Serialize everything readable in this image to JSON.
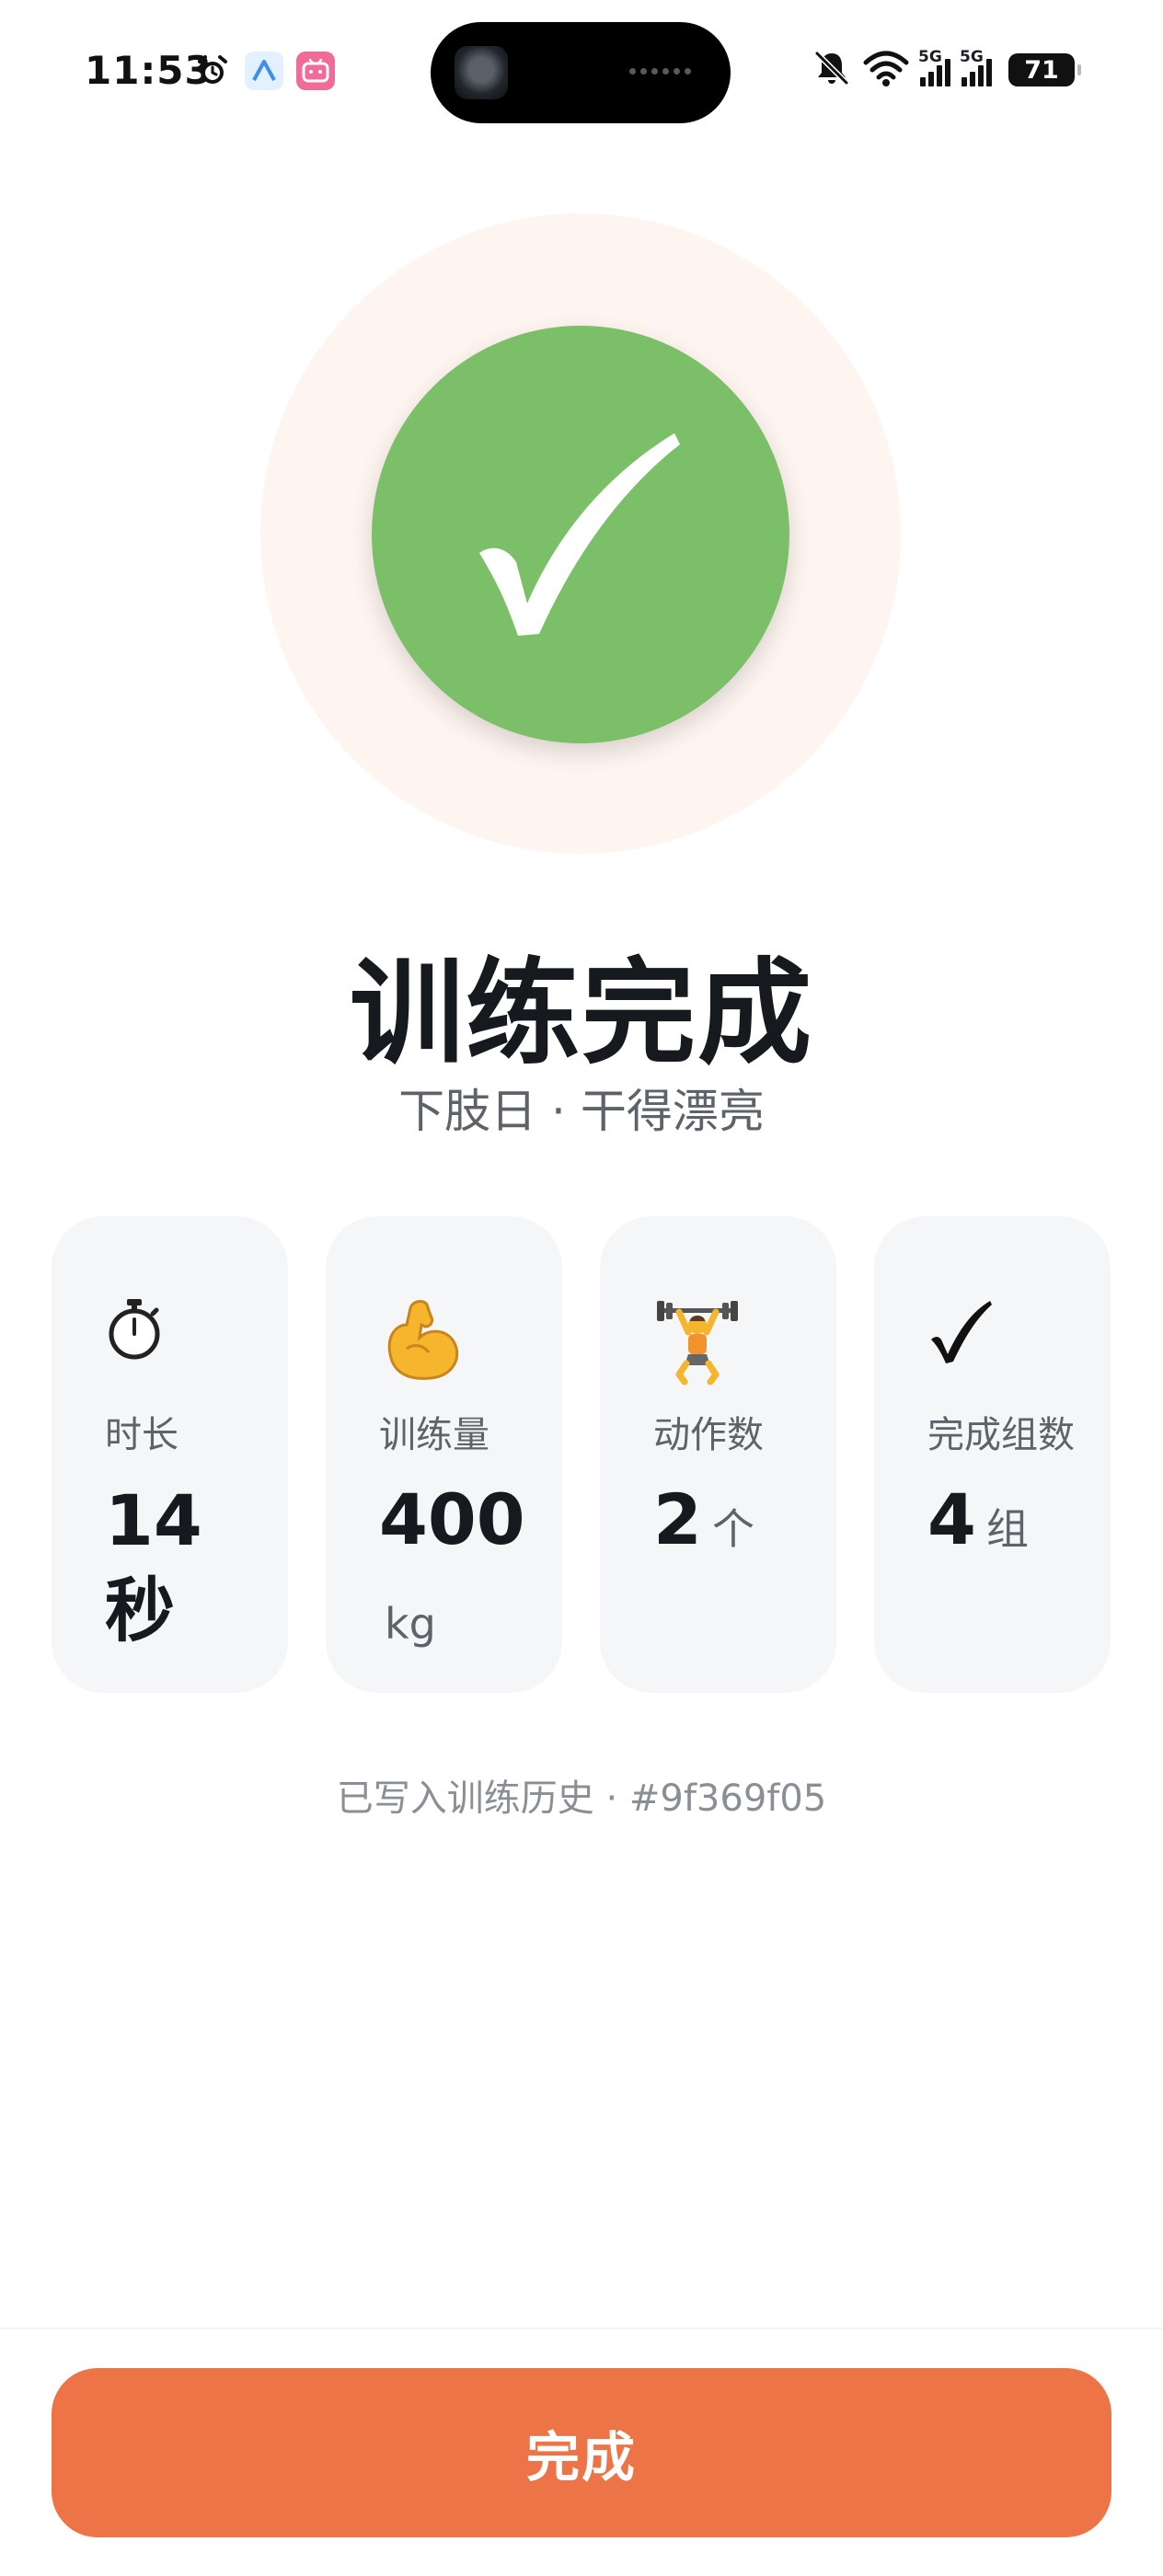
{
  "status_bar": {
    "time": "11:53",
    "network_label_1": "5G",
    "network_label_2": "5G",
    "battery_level": "71",
    "icons": [
      "alarm-icon",
      "app-a-icon",
      "bilibili-icon",
      "mute-bell-icon",
      "wifi-icon",
      "cellular-signal-icon",
      "battery-icon"
    ]
  },
  "badge": {
    "icon": "checkmark-icon",
    "color": "#7bbf69",
    "halo_color": "#fef4f0"
  },
  "title": "训练完成",
  "subtitle": "下肢日 · 干得漂亮",
  "stats": [
    {
      "icon": "stopwatch-icon",
      "label": "时长",
      "value": "14",
      "unit": "秒"
    },
    {
      "icon": "flexed-biceps-icon",
      "label": "训练量",
      "value": "400",
      "unit": "kg"
    },
    {
      "icon": "weightlifter-icon",
      "label": "动作数",
      "value": "2",
      "unit": "个"
    },
    {
      "icon": "checkmark-icon",
      "label": "完成组数",
      "value": "4",
      "unit": "组"
    }
  ],
  "history_note": "已写入训练历史 · #9f369f05",
  "done_button_label": "完成",
  "colors": {
    "accent": "#ed7446",
    "success": "#7bbf69"
  }
}
